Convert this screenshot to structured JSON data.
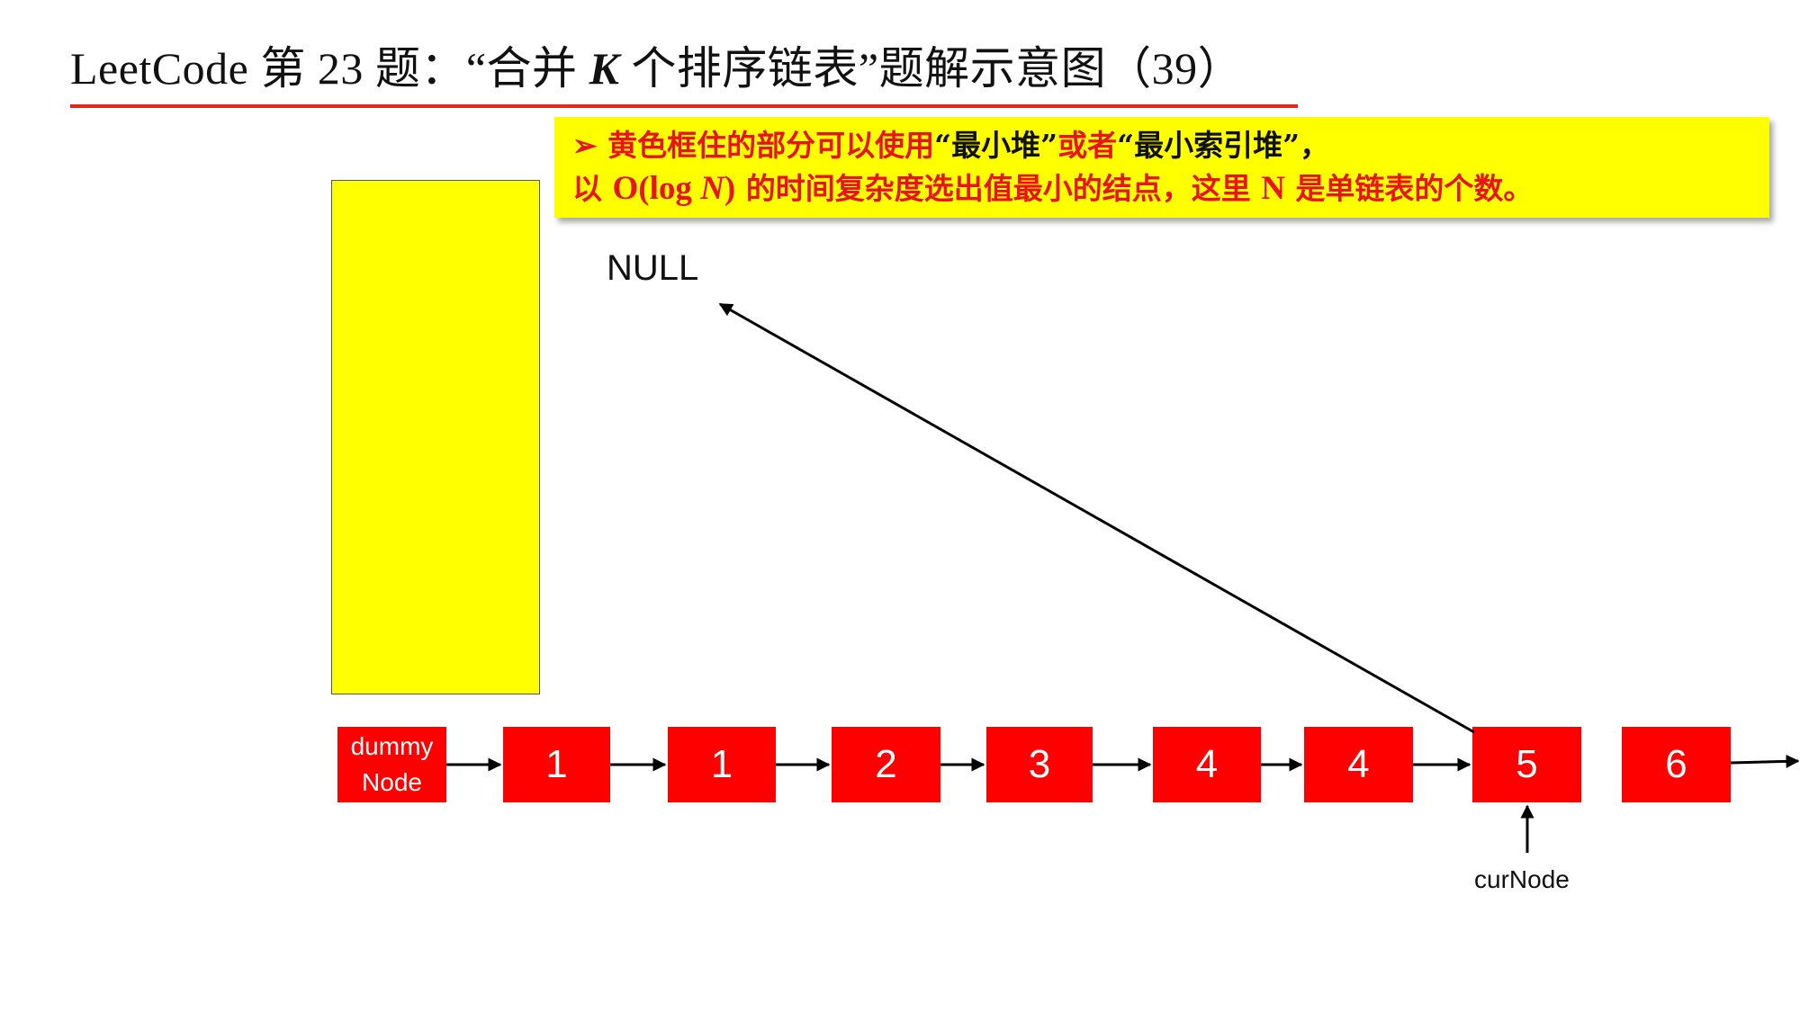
{
  "title": {
    "prefix": "LeetCode 第 23 题：“合并 ",
    "k": "K",
    "suffix": " 个排序链表”题解示意图（39）"
  },
  "note": {
    "bullet": "➢",
    "line1_a": "黄色框住的部分可以使用",
    "line1_b": "“最小堆”",
    "line1_c": "或者",
    "line1_d": "“最小索引堆”",
    "line1_e": "，",
    "line2_a": "以 ",
    "line2_b": "O(log ",
    "line2_c": "N",
    "line2_d": ")",
    "line2_e": " 的时间复杂度选出值最小的结点，这里 ",
    "line2_f": "N",
    "line2_g": " 是单链表的个数。"
  },
  "null_label": "NULL",
  "list": {
    "dummy_line1": "dummy",
    "dummy_line2": "Node",
    "nodes": [
      "1",
      "1",
      "2",
      "3",
      "4",
      "4",
      "5",
      "6"
    ]
  },
  "cur_label": "curNode",
  "colors": {
    "accent_red": "#ff0000",
    "rule_red": "#e8251c",
    "highlight_yellow": "#ffff00"
  }
}
